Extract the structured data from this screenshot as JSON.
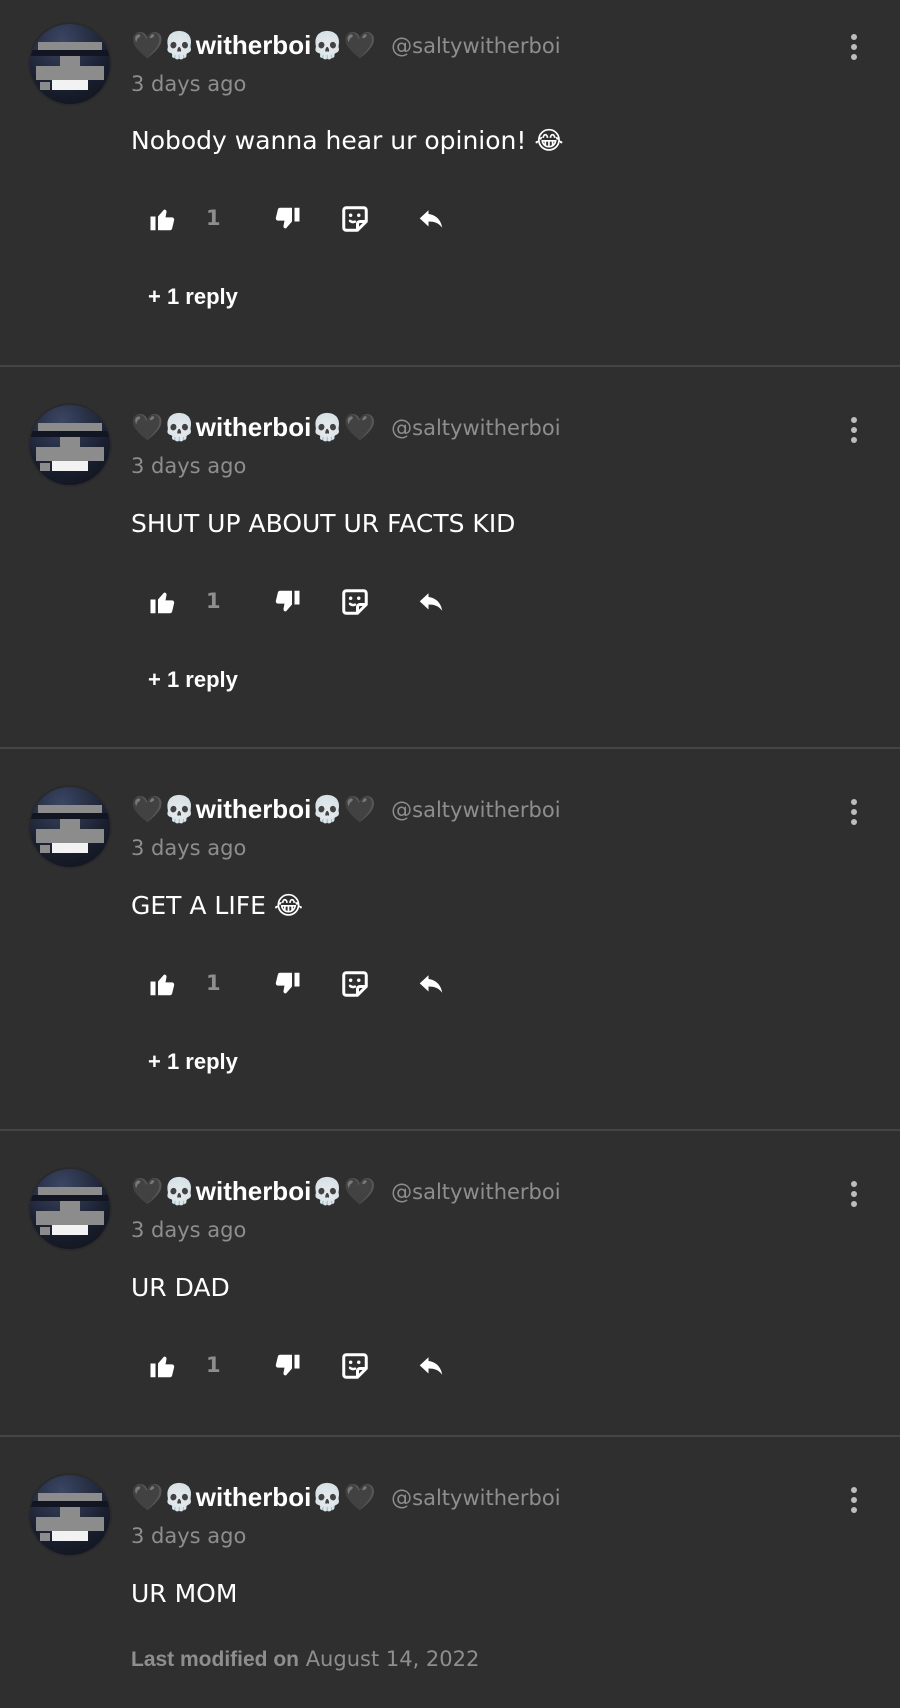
{
  "comments": [
    {
      "display_name": "🖤💀witherboi💀🖤",
      "handle": "@saltywitherboi",
      "time": "3 days ago",
      "text": "Nobody wanna hear ur opinion! 😂",
      "likes": "1",
      "replies_label": "+ 1 reply"
    },
    {
      "display_name": "🖤💀witherboi💀🖤",
      "handle": "@saltywitherboi",
      "time": "3 days ago",
      "text": "SHUT UP ABOUT UR FACTS KID",
      "likes": "1",
      "replies_label": "+ 1 reply"
    },
    {
      "display_name": "🖤💀witherboi💀🖤",
      "handle": "@saltywitherboi",
      "time": "3 days ago",
      "text": "GET A LIFE 😂",
      "likes": "1",
      "replies_label": "+ 1 reply"
    },
    {
      "display_name": "🖤💀witherboi💀🖤",
      "handle": "@saltywitherboi",
      "time": "3 days ago",
      "text": "UR DAD",
      "likes": "1"
    },
    {
      "display_name": "🖤💀witherboi💀🖤",
      "handle": "@saltywitherboi",
      "time": "3 days ago",
      "text": "UR MOM",
      "modified_label": "Last modified on",
      "modified_date": "August 14, 2022"
    }
  ],
  "icons": {
    "like": "thumbs-up-icon",
    "dislike": "thumbs-down-icon",
    "reaction": "sticker-reaction-icon",
    "reply": "reply-icon",
    "more": "more-vertical-icon"
  },
  "colors": {
    "background": "#2f2f2f",
    "divider": "#454545",
    "muted_text": "#8e8e8e",
    "text": "#ffffff"
  }
}
